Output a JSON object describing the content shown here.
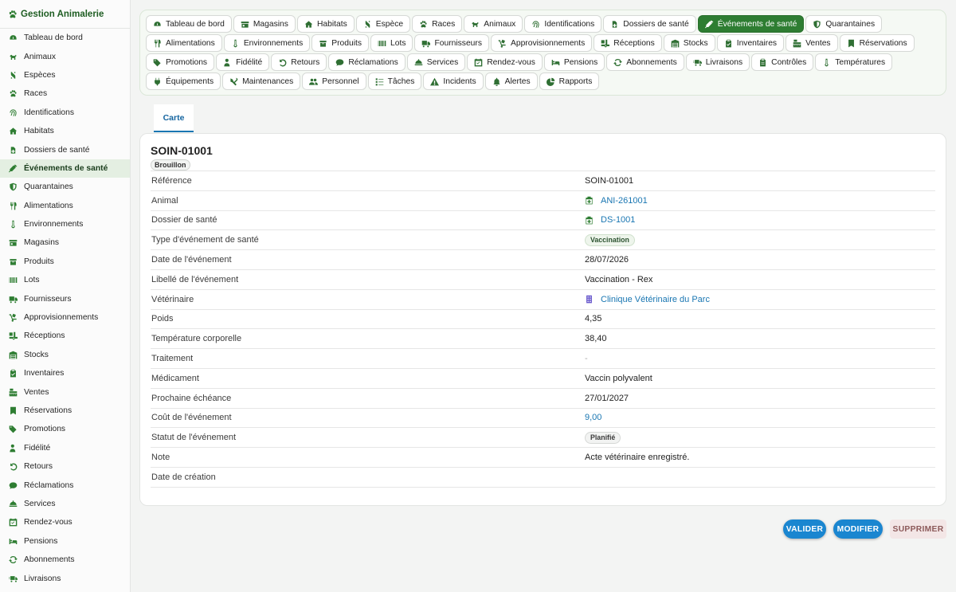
{
  "app": {
    "title": "Gestion Animalerie"
  },
  "sidebar": {
    "items": [
      {
        "label": "Tableau de bord",
        "icon": "dashboard-icon"
      },
      {
        "label": "Animaux",
        "icon": "dog-icon"
      },
      {
        "label": "Espèces",
        "icon": "dna-icon"
      },
      {
        "label": "Races",
        "icon": "paw-icon"
      },
      {
        "label": "Identifications",
        "icon": "fingerprint-icon"
      },
      {
        "label": "Habitats",
        "icon": "house-icon"
      },
      {
        "label": "Dossiers de santé",
        "icon": "medical-file-icon"
      },
      {
        "label": "Événements de santé",
        "icon": "syringe-icon",
        "active": true
      },
      {
        "label": "Quarantaines",
        "icon": "shield-icon"
      },
      {
        "label": "Alimentations",
        "icon": "utensils-icon"
      },
      {
        "label": "Environnements",
        "icon": "thermometer-icon"
      },
      {
        "label": "Magasins",
        "icon": "store-icon"
      },
      {
        "label": "Produits",
        "icon": "box-icon"
      },
      {
        "label": "Lots",
        "icon": "barcode-icon"
      },
      {
        "label": "Fournisseurs",
        "icon": "truck-icon"
      },
      {
        "label": "Approvisionnements",
        "icon": "dolly-icon"
      },
      {
        "label": "Réceptions",
        "icon": "truck-loading-icon"
      },
      {
        "label": "Stocks",
        "icon": "warehouse-icon"
      },
      {
        "label": "Inventaires",
        "icon": "clipboard-check-icon"
      },
      {
        "label": "Ventes",
        "icon": "cash-register-icon"
      },
      {
        "label": "Réservations",
        "icon": "bookmark-icon"
      },
      {
        "label": "Promotions",
        "icon": "tags-icon"
      },
      {
        "label": "Fidélité",
        "icon": "user-tag-icon"
      },
      {
        "label": "Retours",
        "icon": "undo-icon"
      },
      {
        "label": "Réclamations",
        "icon": "comment-icon"
      },
      {
        "label": "Services",
        "icon": "bell-concierge-icon"
      },
      {
        "label": "Rendez-vous",
        "icon": "calendar-check-icon"
      },
      {
        "label": "Pensions",
        "icon": "bed-icon"
      },
      {
        "label": "Abonnements",
        "icon": "sync-icon"
      },
      {
        "label": "Livraisons",
        "icon": "shipping-fast-icon"
      }
    ]
  },
  "tabs": [
    {
      "label": "Tableau de bord",
      "icon": "dashboard-icon"
    },
    {
      "label": "Magasins",
      "icon": "store-icon"
    },
    {
      "label": "Habitats",
      "icon": "house-icon"
    },
    {
      "label": "Espèce",
      "icon": "dna-icon"
    },
    {
      "label": "Races",
      "icon": "paw-icon"
    },
    {
      "label": "Animaux",
      "icon": "dog-icon"
    },
    {
      "label": "Identifications",
      "icon": "fingerprint-icon"
    },
    {
      "label": "Dossiers de santé",
      "icon": "medical-file-icon"
    },
    {
      "label": "Événements de santé",
      "icon": "syringe-icon",
      "active": true
    },
    {
      "label": "Quarantaines",
      "icon": "shield-icon"
    },
    {
      "label": "Alimentations",
      "icon": "utensils-icon"
    },
    {
      "label": "Environnements",
      "icon": "thermometer-icon"
    },
    {
      "label": "Produits",
      "icon": "box-icon"
    },
    {
      "label": "Lots",
      "icon": "barcode-icon"
    },
    {
      "label": "Fournisseurs",
      "icon": "truck-icon"
    },
    {
      "label": "Approvisionnements",
      "icon": "dolly-icon"
    },
    {
      "label": "Réceptions",
      "icon": "truck-loading-icon"
    },
    {
      "label": "Stocks",
      "icon": "warehouse-icon"
    },
    {
      "label": "Inventaires",
      "icon": "clipboard-check-icon"
    },
    {
      "label": "Ventes",
      "icon": "cash-register-icon"
    },
    {
      "label": "Réservations",
      "icon": "bookmark-icon"
    },
    {
      "label": "Promotions",
      "icon": "tags-icon"
    },
    {
      "label": "Fidélité",
      "icon": "user-tag-icon"
    },
    {
      "label": "Retours",
      "icon": "undo-icon"
    },
    {
      "label": "Réclamations",
      "icon": "comment-icon"
    },
    {
      "label": "Services",
      "icon": "bell-concierge-icon"
    },
    {
      "label": "Rendez-vous",
      "icon": "calendar-check-icon"
    },
    {
      "label": "Pensions",
      "icon": "bed-icon"
    },
    {
      "label": "Abonnements",
      "icon": "sync-icon"
    },
    {
      "label": "Livraisons",
      "icon": "shipping-fast-icon"
    },
    {
      "label": "Contrôles",
      "icon": "clipboard-list-icon"
    },
    {
      "label": "Températures",
      "icon": "thermometer-icon"
    },
    {
      "label": "Équipements",
      "icon": "plug-icon"
    },
    {
      "label": "Maintenances",
      "icon": "tools-icon"
    },
    {
      "label": "Personnel",
      "icon": "users-icon"
    },
    {
      "label": "Tâches",
      "icon": "list-check-icon"
    },
    {
      "label": "Incidents",
      "icon": "warning-icon"
    },
    {
      "label": "Alertes",
      "icon": "bell-icon"
    },
    {
      "label": "Rapports",
      "icon": "chart-pie-icon"
    }
  ],
  "view": {
    "tab_label": "Carte"
  },
  "record": {
    "title": "SOIN-01001",
    "status_badge": "Brouillon",
    "fields": [
      {
        "label": "Référence",
        "value": "SOIN-01001",
        "kind": "text"
      },
      {
        "label": "Animal",
        "value": "ANI-261001",
        "kind": "link",
        "icon": "hospital-icon"
      },
      {
        "label": "Dossier de santé",
        "value": "DS-1001",
        "kind": "link",
        "icon": "hospital-icon"
      },
      {
        "label": "Type d'événement de santé",
        "value": "Vaccination",
        "kind": "chip-green"
      },
      {
        "label": "Date de l'événement",
        "value": "28/07/2026",
        "kind": "text"
      },
      {
        "label": "Libellé de l'événement",
        "value": "Vaccination - Rex",
        "kind": "text"
      },
      {
        "label": "Vétérinaire",
        "value": "Clinique Vétérinaire du Parc",
        "kind": "link",
        "icon": "building-icon"
      },
      {
        "label": "Poids",
        "value": "4,35",
        "kind": "text"
      },
      {
        "label": "Température corporelle",
        "value": "38,40",
        "kind": "text"
      },
      {
        "label": "Traitement",
        "value": "-",
        "kind": "dash"
      },
      {
        "label": "Médicament",
        "value": "Vaccin polyvalent",
        "kind": "text"
      },
      {
        "label": "Prochaine échéance",
        "value": "27/01/2027",
        "kind": "text"
      },
      {
        "label": "Coût de l'événement",
        "value": "9,00",
        "kind": "link-plain"
      },
      {
        "label": "Statut de l'événement",
        "value": "Planifié",
        "kind": "chip-grey"
      },
      {
        "label": "Note",
        "value": "Acte vétérinaire enregistré.",
        "kind": "text"
      },
      {
        "label": "Date de création",
        "value": "",
        "kind": "text"
      }
    ]
  },
  "actions": {
    "validate_label": "VALIDER",
    "edit_label": "MODIFIER",
    "delete_label": "SUPPRIMER"
  },
  "colors": {
    "accent_green": "#2e7d32",
    "link_blue": "#1976b2",
    "primary_button": "#1a86d0"
  }
}
